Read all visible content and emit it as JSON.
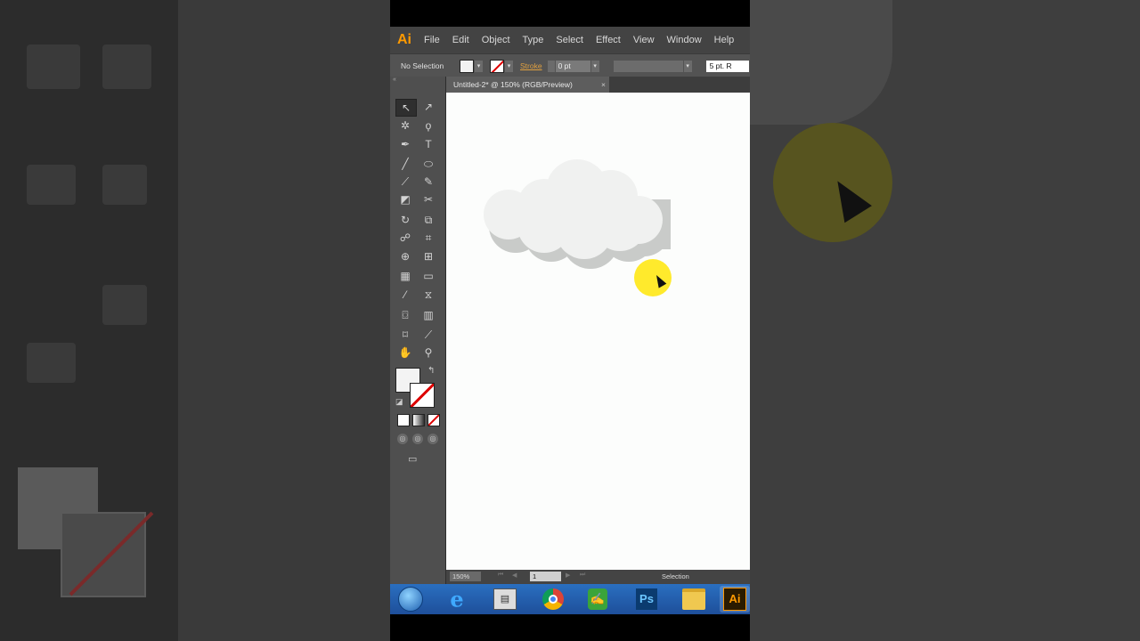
{
  "app": {
    "logo": "Ai",
    "menu": [
      "File",
      "Edit",
      "Object",
      "Type",
      "Select",
      "Effect",
      "View",
      "Window",
      "Help"
    ]
  },
  "control_bar": {
    "selection_label": "No Selection",
    "stroke_label": "Stroke",
    "stroke_weight": "0 pt",
    "brush_label": "5 pt. R"
  },
  "document": {
    "tab_title": "Untitled-2* @ 150% (RGB/Preview)",
    "close_glyph": "×"
  },
  "status_bar": {
    "zoom": "150%",
    "page": "1",
    "tool_status": "Selection"
  },
  "icons": {
    "selection": "selection-tool-icon",
    "direct_selection": "direct-selection-tool-icon",
    "magic_wand": "magic-wand-tool-icon",
    "lasso": "lasso-tool-icon",
    "pen": "pen-tool-icon",
    "type": "type-tool-icon",
    "line": "line-tool-icon",
    "ellipse": "ellipse-tool-icon",
    "paintbrush": "paintbrush-tool-icon",
    "pencil": "pencil-tool-icon",
    "eraser": "eraser-tool-icon",
    "scissors": "scissors-tool-icon",
    "rotate": "rotate-tool-icon",
    "scale": "scale-tool-icon",
    "warp": "warp-tool-icon",
    "free_transform": "free-transform-tool-icon",
    "shape_builder": "shape-builder-tool-icon",
    "perspective": "perspective-grid-tool-icon",
    "mesh": "mesh-tool-icon",
    "gradient": "gradient-tool-icon",
    "eyedropper": "eyedropper-tool-icon",
    "blend": "blend-tool-icon",
    "symbol_sprayer": "symbol-sprayer-tool-icon",
    "graph": "column-graph-tool-icon",
    "artboard": "artboard-tool-icon",
    "slice": "slice-tool-icon",
    "hand": "hand-tool-icon",
    "zoom": "zoom-tool-icon"
  },
  "colors": {
    "ai_orange": "#ff9a00",
    "cloud_light": "#f0f1f0",
    "cloud_shadow": "#c8cac8",
    "cursor_highlight": "#ffe81a",
    "taskbar_blue": "#2a6fc0"
  }
}
